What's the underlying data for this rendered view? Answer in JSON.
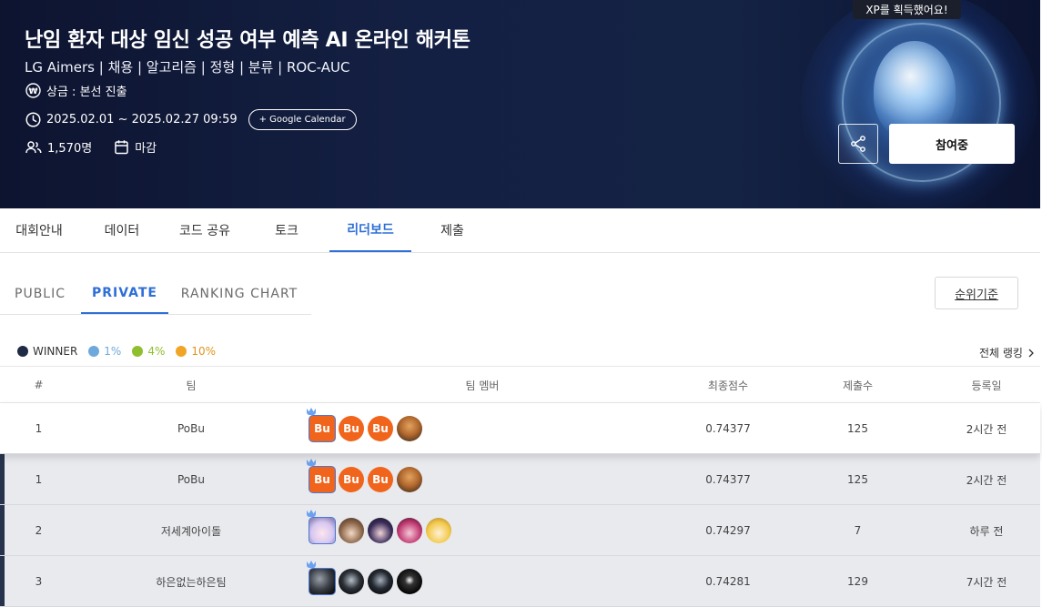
{
  "banner": {
    "title": "난임 환자 대상 임신 성공 여부 예측 AI 온라인 해커톤",
    "subtitle": "LG Aimers | 채용 | 알고리즘 | 정형 | 분류 | ROC-AUC",
    "prize": "상금 : 본선 진출",
    "period": "2025.02.01 ~ 2025.02.27 09:59",
    "google_calendar": "+ Google Calendar",
    "participants": "1,570명",
    "status": "마감",
    "xp_toast": "XP를 획득했어요!",
    "join_label": "참여중"
  },
  "main_tabs": [
    "대회안내",
    "데이터",
    "코드 공유",
    "토크",
    "리더보드",
    "제출"
  ],
  "sub_tabs": [
    "PUBLIC",
    "PRIVATE",
    "RANKING CHART"
  ],
  "criteria_label": "순위기준",
  "legend": [
    {
      "label": "WINNER",
      "color": "#1f2a44"
    },
    {
      "label": "1%",
      "color": "#6fa8dc"
    },
    {
      "label": "4%",
      "color": "#8fbf2f"
    },
    {
      "label": "10%",
      "color": "#f0a526"
    }
  ],
  "full_ranking": "전체 랭킹",
  "table": {
    "headers": [
      "#",
      "팀",
      "팀 멤버",
      "최종점수",
      "제출수",
      "등록일"
    ],
    "rows": [
      {
        "rank": "1",
        "team": "PoBu",
        "score": "0.74377",
        "count": "125",
        "date": "2시간 전"
      },
      {
        "rank": "1",
        "team": "PoBu",
        "score": "0.74377",
        "count": "125",
        "date": "2시간 전"
      },
      {
        "rank": "2",
        "team": "저세계아이돌",
        "score": "0.74297",
        "count": "7",
        "date": "하루 전"
      },
      {
        "rank": "3",
        "team": "하은없는하은팀",
        "score": "0.74281",
        "count": "129",
        "date": "7시간 전"
      }
    ],
    "avatar_text": "Bu"
  }
}
